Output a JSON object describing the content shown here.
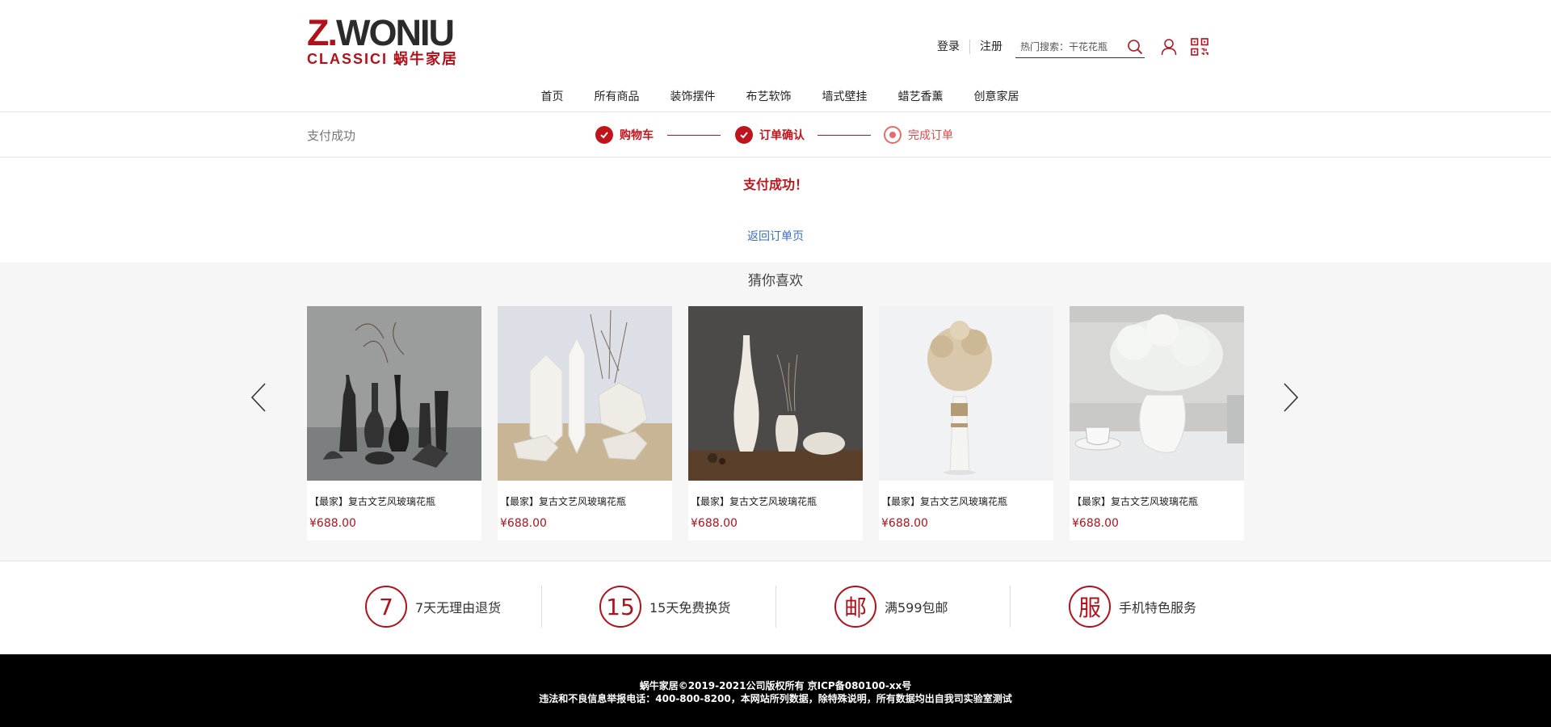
{
  "header": {
    "logo_main_z": "Z.",
    "logo_main_rest": "WONIU",
    "logo_sub": "CLASSICI 蜗牛家居",
    "login_label": "登录",
    "register_label": "注册",
    "search_placeholder": "热门搜索：干花花瓶",
    "icons": [
      "search-icon",
      "user-icon",
      "qrcode-icon"
    ]
  },
  "nav": {
    "items": [
      "首页",
      "所有商品",
      "装饰摆件",
      "布艺软饰",
      "墙式壁挂",
      "蜡艺香薰",
      "创意家居"
    ]
  },
  "steps": {
    "title": "支付成功",
    "items": [
      {
        "label": "购物车",
        "status": "done"
      },
      {
        "label": "订单确认",
        "status": "done"
      },
      {
        "label": "完成订单",
        "status": "current"
      }
    ]
  },
  "success": {
    "message": "支付成功！",
    "back_link": "返回订单页"
  },
  "recommend": {
    "title": "猜你喜欢",
    "products": [
      {
        "name": "【最家】复古文艺风玻璃花瓶",
        "price": "¥688.00"
      },
      {
        "name": "【最家】复古文艺风玻璃花瓶",
        "price": "¥688.00"
      },
      {
        "name": "【最家】复古文艺风玻璃花瓶",
        "price": "¥688.00"
      },
      {
        "name": "【最家】复古文艺风玻璃花瓶",
        "price": "¥688.00"
      },
      {
        "name": "【最家】复古文艺风玻璃花瓶",
        "price": "¥688.00"
      }
    ]
  },
  "services": [
    {
      "icon_text": "7",
      "label": "7天无理由退货"
    },
    {
      "icon_text": "15",
      "label": "15天免费换货"
    },
    {
      "icon_text": "邮",
      "label": "满599包邮"
    },
    {
      "icon_text": "服",
      "label": "手机特色服务"
    }
  ],
  "footer": {
    "line1": "蜗牛家居©2019-2021公司版权所有 京ICP备080100-xx号",
    "line2": "违法和不良信息举报电话：400-800-8200，本网站所列数据，除特殊说明，所有数据均出自我司实验室测试"
  },
  "colors": {
    "brand_red": "#b0121b",
    "link_blue": "#3b6fc4",
    "footer_bg": "#000000",
    "recommend_bg": "#f6f6f6"
  }
}
